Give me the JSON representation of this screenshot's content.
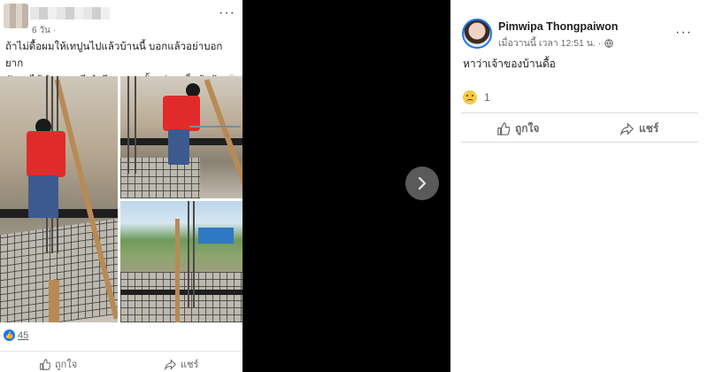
{
  "left_post": {
    "time": "6 วัน ·",
    "more": "···",
    "text_line1": "ถ้าไม่ดื้อผมให้เทปูนไปแล้วบ้านนี้ บอกแล้วอย่าบอกยาก",
    "text_line2": "มันจะได้ทำหลายที ทำดี ๆ จบ ๆ ตั้งแต่แรกก็แล้วน้า 👻",
    "reaction_count": "45",
    "actions": {
      "like": "ถูกใจ",
      "share": "แชร์"
    }
  },
  "viewer": {
    "next_icon": "chevron-right-icon"
  },
  "right_panel": {
    "name": "Pimwipa Thongpaiwon",
    "meta_time": "เมื่อวานนี้ เวลา 12:51 น. ·",
    "more": "···",
    "caption": "หาว่าเจ้าของบ้านดื้อ",
    "reaction_count": "1",
    "actions": {
      "like": "ถูกใจ",
      "share": "แชร์"
    }
  },
  "colors": {
    "accent": "#1877f2",
    "shirt": "#e12b2b"
  }
}
